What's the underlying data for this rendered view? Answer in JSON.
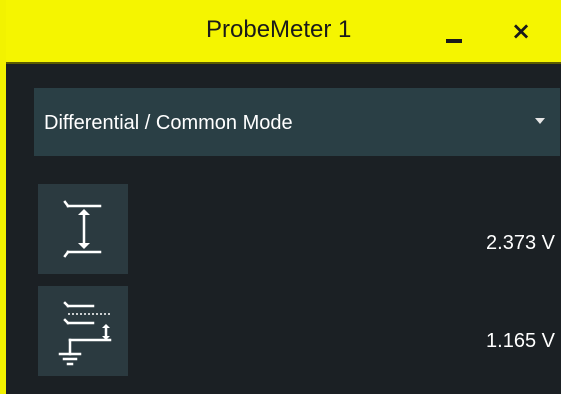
{
  "window": {
    "title": "ProbeMeter 1",
    "minimize_icon": "minimize-icon",
    "close_label": "×",
    "close_icon": "close-icon"
  },
  "mode_select": {
    "selected": "Differential / Common Mode",
    "arrow_icon": "dropdown-arrow-icon"
  },
  "measurements": [
    {
      "icon": "differential-voltage-icon",
      "value": "2.373 V"
    },
    {
      "icon": "common-mode-voltage-icon",
      "value": "1.165 V"
    }
  ],
  "colors": {
    "titlebar": "#f5f500",
    "background": "#1b2024",
    "dropdown": "#2a3f45",
    "icon_tile": "#2b3a40",
    "text": "#ffffff"
  }
}
